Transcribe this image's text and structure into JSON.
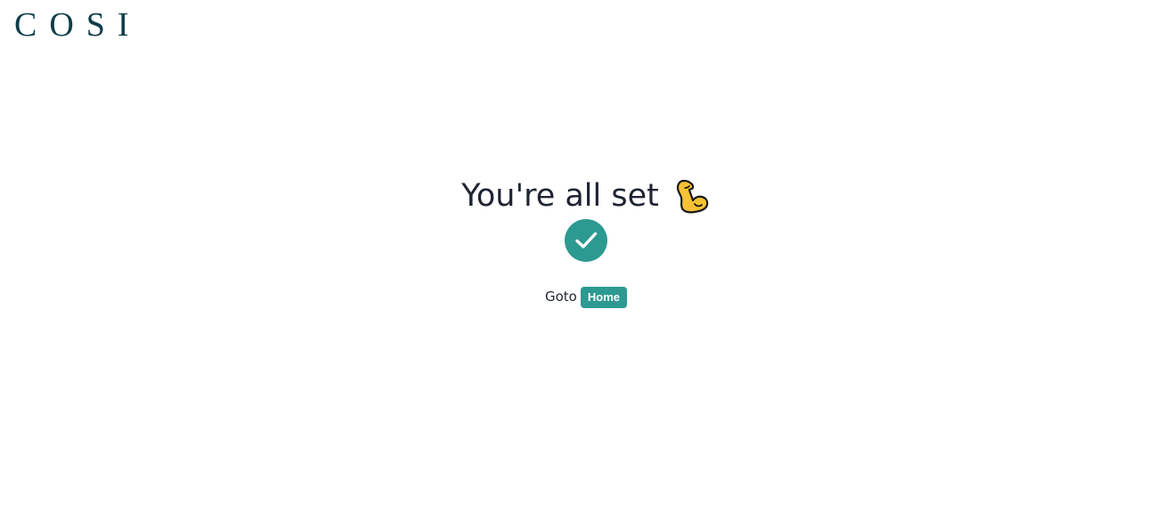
{
  "brand": {
    "logo_text": "COSI"
  },
  "main": {
    "headline": "You're all set",
    "headline_emoji": "flexed-biceps-icon",
    "status_icon": "checkmark-icon",
    "goto_label": "Goto",
    "home_button_label": "Home"
  },
  "colors": {
    "brand": "#0f3d4a",
    "accent": "#2c9a91",
    "text": "#1f2433",
    "emoji_fill": "#f7c236"
  }
}
